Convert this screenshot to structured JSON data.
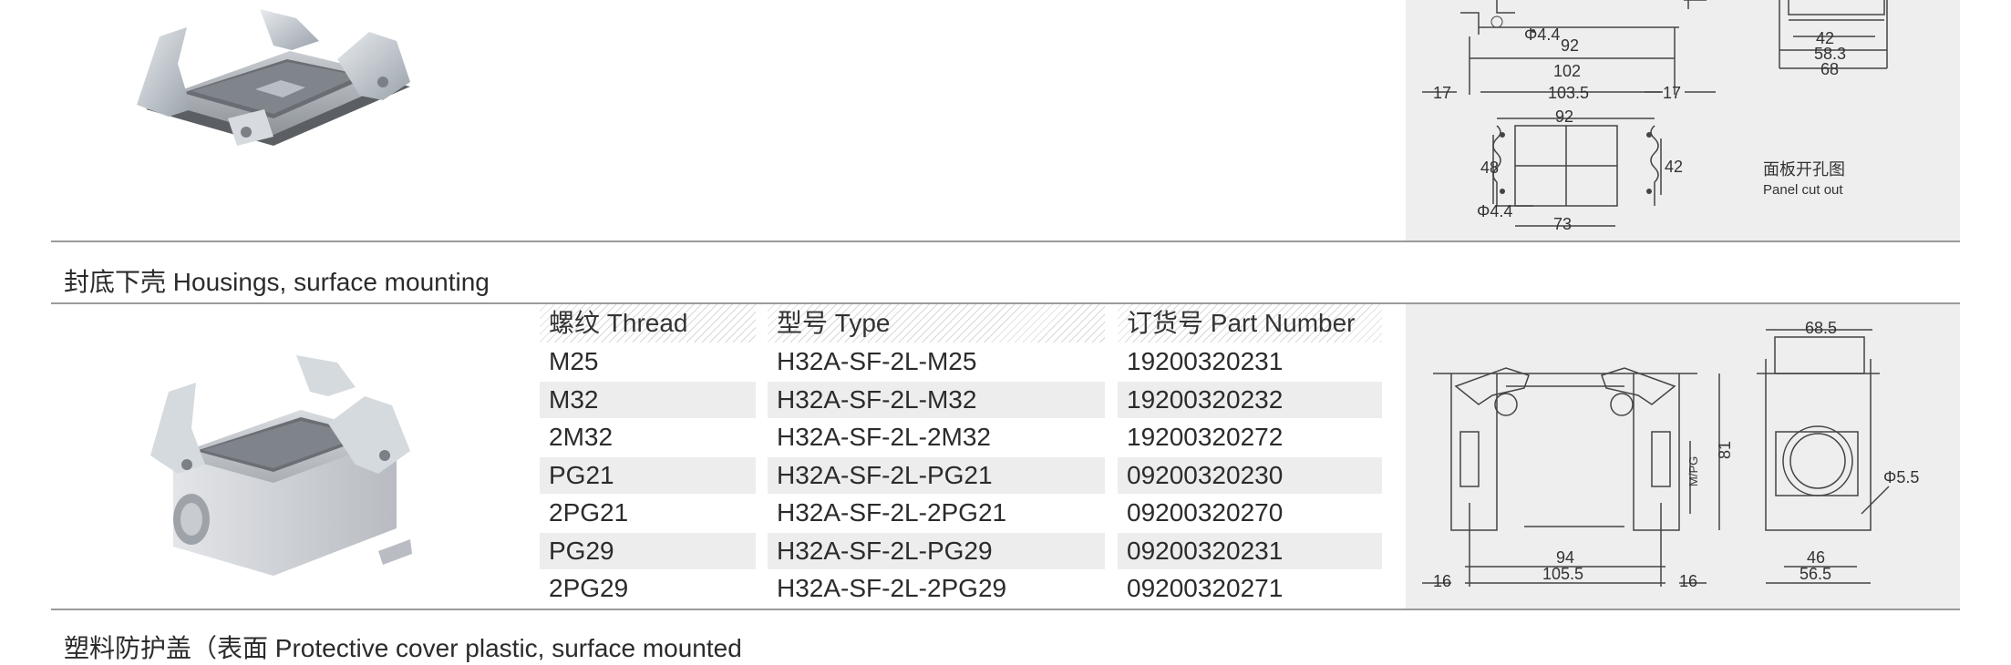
{
  "section": {
    "title": "封底下壳 Housings, surface mounting",
    "next_title_partial": "塑料防护盖（表面 Protective cover plastic, surface mounted"
  },
  "top_drawing": {
    "dim_hole": "Φ4.4",
    "dim_92": "92",
    "dim_102": "102",
    "dim_103_5": "103.5",
    "dim_17_left": "17",
    "dim_17_right": "17",
    "dim_42": "42",
    "dim_58_3": "58.3",
    "dim_68": "68",
    "cutout_92": "92",
    "cutout_48": "48",
    "cutout_42": "42",
    "cutout_hole": "Φ4.4",
    "cutout_73": "73",
    "caption_zh": "面板开孔图",
    "caption_en": "Panel cut out"
  },
  "table": {
    "headers": [
      "螺纹 Thread",
      "型号 Type",
      "订货号 Part Number"
    ],
    "rows": [
      [
        "M25",
        "H32A-SF-2L-M25",
        "19200320231"
      ],
      [
        "M32",
        "H32A-SF-2L-M32",
        "19200320232"
      ],
      [
        "2M32",
        "H32A-SF-2L-2M32",
        "19200320272"
      ],
      [
        "PG21",
        "H32A-SF-2L-PG21",
        "09200320230"
      ],
      [
        "2PG21",
        "H32A-SF-2L-2PG21",
        "09200320270"
      ],
      [
        "PG29",
        "H32A-SF-2L-PG29",
        "09200320231"
      ],
      [
        "2PG29",
        "H32A-SF-2L-2PG29",
        "09200320271"
      ]
    ]
  },
  "bottom_drawing": {
    "dim_68_5": "68.5",
    "dim_81": "81",
    "dim_mpg": "M/PG",
    "dim_hole": "Φ5.5",
    "dim_94": "94",
    "dim_105_5": "105.5",
    "dim_16_left": "16",
    "dim_16_right": "16",
    "dim_46": "46",
    "dim_56_5": "56.5"
  }
}
